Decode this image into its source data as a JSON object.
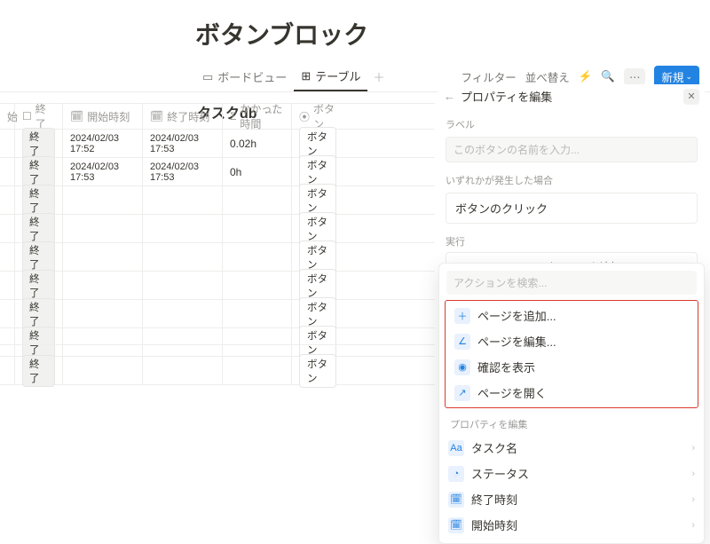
{
  "page": {
    "title": "ボタンブロック"
  },
  "views": {
    "board": "ボードビュー",
    "table": "テーブル",
    "add": "＋"
  },
  "toolbar_right": {
    "filter": "フィルター",
    "sort": "並べ替え",
    "new_btn": "新規"
  },
  "database": {
    "title": "タスクdb",
    "more": "⋯"
  },
  "columns": {
    "start": "始",
    "end": "終了",
    "start_time": "開始時刻",
    "end_time": "終了時刻",
    "duration": "かかった時間",
    "button": "ボタン"
  },
  "rows": [
    {
      "end": "終了",
      "start_time": "2024/02/03 17:52",
      "end_time": "2024/02/03 17:53",
      "duration": "0.02h",
      "btn": "ボタン"
    },
    {
      "end": "終了",
      "start_time": "2024/02/03 17:53",
      "end_time": "2024/02/03 17:53",
      "duration": "0h",
      "btn": "ボタン"
    },
    {
      "end": "終了",
      "start_time": "",
      "end_time": "",
      "duration": "",
      "btn": "ボタン"
    },
    {
      "end": "終了",
      "start_time": "",
      "end_time": "",
      "duration": "",
      "btn": "ボタン"
    },
    {
      "end": "終了",
      "start_time": "",
      "end_time": "",
      "duration": "",
      "btn": "ボタン"
    },
    {
      "end": "終了",
      "start_time": "",
      "end_time": "",
      "duration": "",
      "btn": "ボタン"
    },
    {
      "end": "終了",
      "start_time": "",
      "end_time": "",
      "duration": "",
      "btn": "ボタン"
    },
    {
      "end": "終了",
      "start_time": "",
      "end_time": "",
      "duration": "",
      "btn": "ボタン"
    },
    {
      "end": "終了",
      "start_time": "",
      "end_time": "",
      "duration": "",
      "btn": "ボタン"
    }
  ],
  "panel": {
    "back": "←",
    "title": "プロパティを編集",
    "label_label": "ラベル",
    "label_placeholder": "このボタンの名前を入力...",
    "trigger_label": "いずれかが発生した場合",
    "trigger_value": "ボタンのクリック",
    "action_label": "実行",
    "add_action": "アクションを追加"
  },
  "popup": {
    "search_placeholder": "アクションを検索...",
    "actions": [
      {
        "icon": "plus-icon",
        "label": "ページを追加..."
      },
      {
        "icon": "pencil-icon",
        "label": "ページを編集..."
      },
      {
        "icon": "eye-icon",
        "label": "確認を表示"
      },
      {
        "icon": "open-icon",
        "label": "ページを開く"
      }
    ],
    "props_header": "プロパティを編集",
    "props": [
      {
        "icon": "text-icon",
        "label": "タスク名"
      },
      {
        "icon": "status-icon",
        "label": "ステータス"
      },
      {
        "icon": "date-icon",
        "label": "終了時刻"
      },
      {
        "icon": "date-icon",
        "label": "開始時刻"
      }
    ]
  }
}
